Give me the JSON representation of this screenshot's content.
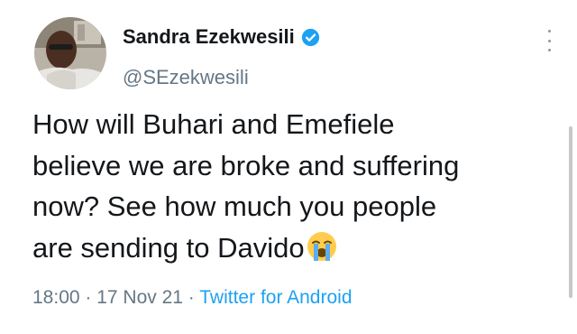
{
  "user": {
    "display_name": "Sandra Ezekwesili",
    "handle": "@SEzekwesili",
    "verified": true
  },
  "tweet": {
    "text_lines": [
      "How will Buhari and Emefiele",
      "believe we are broke and suffering",
      "now? See how much you people",
      "are sending to Davido"
    ],
    "emoji": "loudly-crying-face"
  },
  "meta": {
    "time": "18:00",
    "separator": " · ",
    "date": "17 Nov 21",
    "source": "Twitter for Android"
  },
  "colors": {
    "text": "#14171a",
    "secondary": "#657786",
    "accent": "#1da1f2"
  }
}
